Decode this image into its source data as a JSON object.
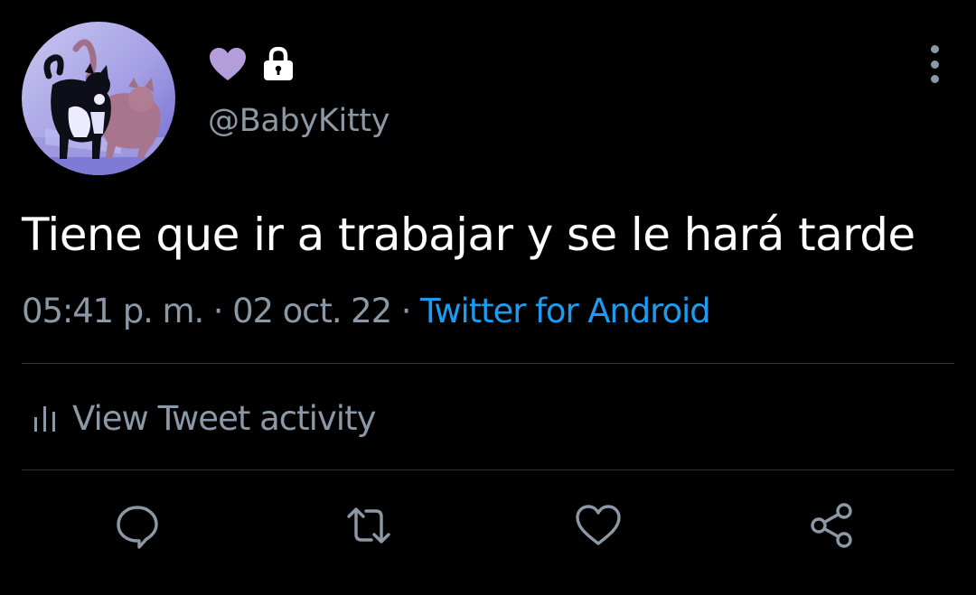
{
  "tweet": {
    "author": {
      "display_icons": [
        "purple-heart-emoji",
        "lock-icon"
      ],
      "handle": "@BabyKitty"
    },
    "text": "Tiene que ir a trabajar y se le hará tarde",
    "meta": {
      "time": "05:41 p. m.",
      "separator": " · ",
      "date": "02 oct. 22",
      "source": "Twitter for Android"
    },
    "activity": {
      "icon": "bar-chart-icon",
      "label": "View Tweet activity"
    },
    "actions": [
      "reply-icon",
      "retweet-icon",
      "like-icon",
      "share-icon"
    ]
  },
  "colors": {
    "background": "#000000",
    "text_primary": "#ffffff",
    "text_secondary": "#8b98a5",
    "link": "#1d9bf0",
    "heart_emoji": "#b39ddb",
    "divider": "#2f3336"
  }
}
